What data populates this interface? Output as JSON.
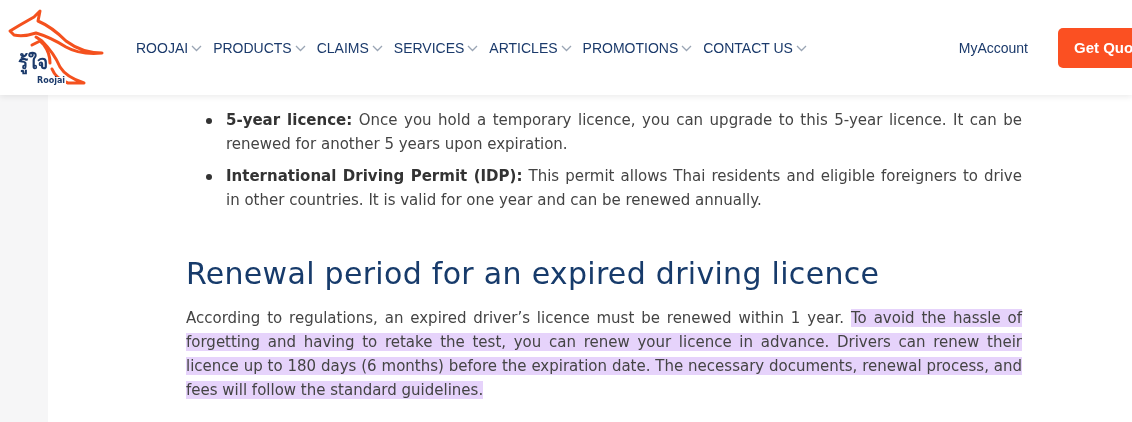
{
  "header": {
    "logo": {
      "thai": "รู้ใจ",
      "latin": "Roojai"
    },
    "nav": [
      {
        "label": "ROOJAI"
      },
      {
        "label": "PRODUCTS"
      },
      {
        "label": "CLAIMS"
      },
      {
        "label": "SERVICES"
      },
      {
        "label": "ARTICLES"
      },
      {
        "label": "PROMOTIONS"
      },
      {
        "label": "CONTACT US"
      }
    ],
    "account_link": "MyAccount",
    "cta_button": "Get Quo"
  },
  "article": {
    "bullets": [
      "**5-year licence:** Once you hold a temporary licence, you can upgrade to this 5-year licence. It can be renewed for another 5 years upon expiration.",
      "**International Driving Permit (IDP):** This permit allows Thai residents and eligible foreigners to drive in other countries. It is valid for one year and can be renewed annually."
    ],
    "heading": "Renewal period for an expired driving licence",
    "paragraph": [
      {
        "text": "According to regulations, an expired driver’s licence must be renewed within 1 year. ",
        "highlighted": false
      },
      {
        "text": "To avoid the hassle of forgetting and having to retake the test, you can renew your licence in advance. Drivers can renew their licence up to 180 days (6 months) before the expiration date. The necessary documents, renewal process, and fees will follow the standard guidelines.",
        "highlighted": true
      }
    ]
  }
}
